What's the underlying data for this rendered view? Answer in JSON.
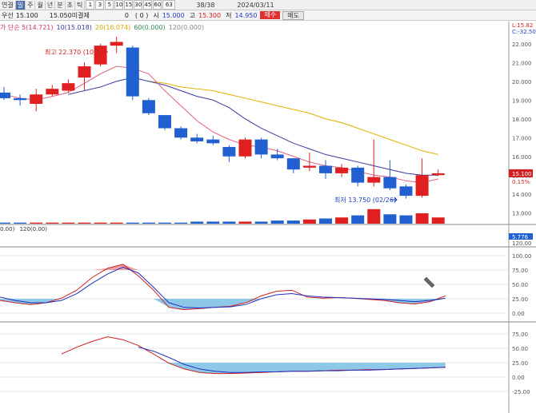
{
  "toolbar": {
    "tabs": [
      "연결",
      "일",
      "주",
      "월",
      "년",
      "분",
      "초",
      "틱"
    ],
    "selected_tab": 1,
    "periods": [
      "1",
      "3",
      "5",
      "10",
      "15",
      "30",
      "45",
      "60"
    ],
    "count_box": "63",
    "count_display": "38/38",
    "date": "2024/03/11"
  },
  "quote": {
    "label_prev": "우선",
    "prev": "15.100",
    "bid": "15.050",
    "unfilled_label": "미결제",
    "unfilled": "0",
    "paren": "( 0 )",
    "open_label": "시",
    "open": "15.000",
    "high_label": "고",
    "high": "15.300",
    "low_label": "저",
    "low": "14.950",
    "buy": "매수",
    "sell": "매도"
  },
  "ma_legend": {
    "prefix": "가 단순",
    "items": [
      {
        "text": "5(14.721)",
        "color": "#d0306a"
      },
      {
        "text": "10(15.018)",
        "color": "#3a3aa0"
      },
      {
        "text": "20(16.074)",
        "color": "#d8a800"
      },
      {
        "text": "60(0.000)",
        "color": "#2e8b57"
      },
      {
        "text": "120(0.000)",
        "color": "#888888"
      }
    ]
  },
  "annotations": {
    "high": "최고 22.370 (10/23)",
    "low": "최저 13.750 (02/26)"
  },
  "price_axis": {
    "ticks": [
      "22.000",
      "21.000",
      "20.000",
      "19.000",
      "18.000",
      "17.000",
      "16.000",
      "15.000",
      "14.000",
      "13.000"
    ],
    "top_labels": [
      "L:15.82",
      "C:-32.50"
    ],
    "current": "15.100",
    "pct": "0.15%"
  },
  "volume_legend": {
    "a": "0.00)",
    "b": "120(0.00)"
  },
  "volume_axis": {
    "labels": [
      "5.776",
      "120.00"
    ]
  },
  "osc1_axis": {
    "ticks": [
      "100.00",
      "75.00",
      "50.00",
      "25.00",
      "0.00"
    ]
  },
  "osc2_axis": {
    "ticks": [
      "75.00",
      "50.00",
      "25.00",
      "0.00",
      "-25.00"
    ]
  },
  "chart_data": {
    "type": "candlestick",
    "ylim": [
      12.5,
      22.8
    ],
    "candles": [
      {
        "o": 19.4,
        "h": 19.7,
        "l": 19.0,
        "c": 19.1
      },
      {
        "o": 19.1,
        "h": 19.3,
        "l": 18.7,
        "c": 19.0
      },
      {
        "o": 18.8,
        "h": 19.6,
        "l": 18.4,
        "c": 19.3
      },
      {
        "o": 19.3,
        "h": 19.8,
        "l": 19.2,
        "c": 19.6
      },
      {
        "o": 19.5,
        "h": 20.1,
        "l": 19.4,
        "c": 19.9
      },
      {
        "o": 20.2,
        "h": 21.0,
        "l": 19.5,
        "c": 20.8
      },
      {
        "o": 20.9,
        "h": 22.0,
        "l": 20.8,
        "c": 21.9
      },
      {
        "o": 21.9,
        "h": 22.37,
        "l": 21.5,
        "c": 22.1
      },
      {
        "o": 21.8,
        "h": 21.9,
        "l": 19.0,
        "c": 19.2
      },
      {
        "o": 19.0,
        "h": 19.1,
        "l": 18.2,
        "c": 18.3
      },
      {
        "o": 18.2,
        "h": 18.2,
        "l": 17.4,
        "c": 17.5
      },
      {
        "o": 17.5,
        "h": 17.6,
        "l": 16.9,
        "c": 17.0
      },
      {
        "o": 17.0,
        "h": 17.2,
        "l": 16.7,
        "c": 16.8
      },
      {
        "o": 16.9,
        "h": 17.1,
        "l": 16.6,
        "c": 16.7
      },
      {
        "o": 16.5,
        "h": 16.6,
        "l": 15.7,
        "c": 16.0
      },
      {
        "o": 16.0,
        "h": 17.0,
        "l": 15.9,
        "c": 16.9
      },
      {
        "o": 16.9,
        "h": 17.0,
        "l": 15.9,
        "c": 16.1
      },
      {
        "o": 16.1,
        "h": 16.4,
        "l": 15.8,
        "c": 15.9
      },
      {
        "o": 15.9,
        "h": 15.9,
        "l": 15.1,
        "c": 15.3
      },
      {
        "o": 15.4,
        "h": 16.2,
        "l": 15.2,
        "c": 15.5
      },
      {
        "o": 15.5,
        "h": 15.8,
        "l": 14.8,
        "c": 15.1
      },
      {
        "o": 15.1,
        "h": 15.6,
        "l": 14.9,
        "c": 15.4
      },
      {
        "o": 15.4,
        "h": 15.5,
        "l": 14.4,
        "c": 14.6
      },
      {
        "o": 14.6,
        "h": 16.9,
        "l": 14.4,
        "c": 14.9
      },
      {
        "o": 14.9,
        "h": 15.8,
        "l": 14.2,
        "c": 14.3
      },
      {
        "o": 14.4,
        "h": 14.5,
        "l": 13.75,
        "c": 13.9
      },
      {
        "o": 13.9,
        "h": 15.9,
        "l": 13.8,
        "c": 15.0
      },
      {
        "o": 15.0,
        "h": 15.3,
        "l": 14.95,
        "c": 15.1
      }
    ],
    "ma5": [
      19.3,
      19.1,
      19.0,
      19.2,
      19.4,
      19.9,
      20.4,
      20.8,
      20.7,
      20.4,
      19.5,
      18.7,
      17.9,
      17.3,
      16.9,
      16.6,
      16.5,
      16.3,
      16.0,
      15.7,
      15.5,
      15.4,
      15.2,
      15.0,
      14.9,
      14.7,
      14.6,
      14.8
    ],
    "ma10": [
      null,
      null,
      null,
      null,
      19.3,
      19.5,
      19.7,
      20.0,
      20.2,
      20.0,
      19.8,
      19.5,
      19.2,
      19.0,
      18.6,
      18.0,
      17.5,
      17.1,
      16.7,
      16.4,
      16.1,
      15.9,
      15.7,
      15.5,
      15.3,
      15.1,
      15.0,
      15.0
    ],
    "ma20": [
      null,
      null,
      null,
      null,
      null,
      null,
      null,
      null,
      null,
      20.0,
      19.9,
      19.7,
      19.6,
      19.5,
      19.3,
      19.1,
      18.9,
      18.7,
      18.5,
      18.3,
      18.0,
      17.8,
      17.5,
      17.2,
      16.9,
      16.6,
      16.3,
      16.1
    ],
    "volume": [
      1,
      1,
      1,
      1,
      1,
      1,
      1,
      1,
      1,
      1,
      1,
      1,
      2,
      2,
      2,
      2,
      2,
      3,
      3,
      4,
      5,
      6,
      8,
      14,
      9,
      8,
      10,
      6
    ],
    "osc1_k": [
      22,
      18,
      15,
      18,
      26,
      40,
      62,
      78,
      85,
      65,
      40,
      10,
      6,
      8,
      10,
      12,
      18,
      30,
      38,
      40,
      28,
      26,
      27,
      26,
      24,
      22,
      18,
      16,
      20,
      30
    ],
    "osc1_d": [
      28,
      22,
      18,
      18,
      22,
      34,
      52,
      68,
      80,
      70,
      45,
      18,
      10,
      9,
      10,
      11,
      15,
      25,
      32,
      34,
      30,
      28,
      27,
      26,
      25,
      24,
      22,
      20,
      22,
      26
    ],
    "osc2_k": [
      null,
      null,
      null,
      null,
      40,
      52,
      62,
      70,
      65,
      55,
      40,
      24,
      14,
      8,
      6,
      6,
      7,
      8,
      9,
      10,
      10,
      11,
      12,
      12,
      13,
      13,
      14,
      15,
      16,
      17
    ],
    "osc2_d": [
      null,
      null,
      null,
      null,
      null,
      null,
      null,
      null,
      null,
      52,
      45,
      34,
      22,
      14,
      10,
      8,
      8,
      9,
      9,
      10,
      10,
      11,
      11,
      12,
      12,
      13,
      14,
      15,
      16,
      17
    ]
  }
}
